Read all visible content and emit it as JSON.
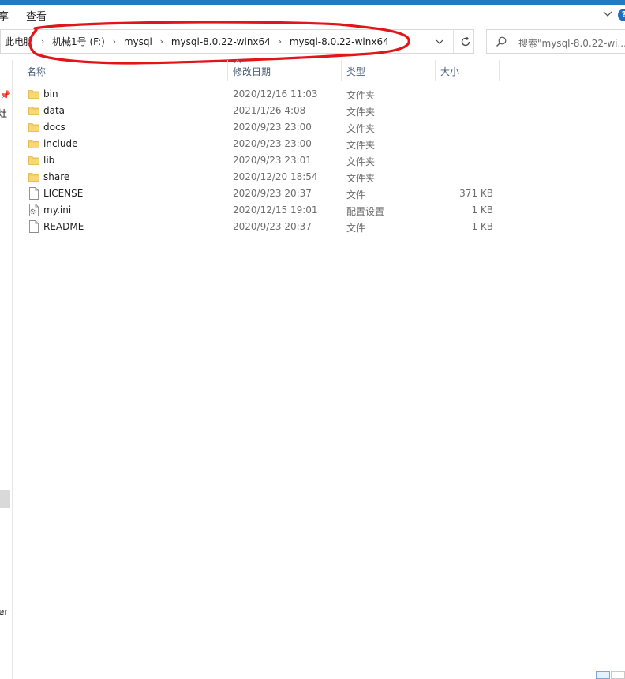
{
  "ribbon": {
    "tab_partial": "享",
    "tab_view": "查看",
    "help_label": "?"
  },
  "address": {
    "crumbs": [
      "此电脑",
      "机械1号 (F:)",
      "mysql",
      "mysql-8.0.22-winx64",
      "mysql-8.0.22-winx64"
    ]
  },
  "search": {
    "placeholder": "搜索\"mysql-8.0.22-wi..."
  },
  "columns": {
    "name": "名称",
    "date": "修改日期",
    "type": "类型",
    "size": "大小"
  },
  "nav": {
    "fragment_top": "灶",
    "fragment_bottom": "er"
  },
  "files": [
    {
      "name": "bin",
      "date": "2020/12/16 11:03",
      "type": "文件夹",
      "size": "",
      "icon": "folder-icon"
    },
    {
      "name": "data",
      "date": "2021/1/26 4:08",
      "type": "文件夹",
      "size": "",
      "icon": "folder-icon"
    },
    {
      "name": "docs",
      "date": "2020/9/23 23:00",
      "type": "文件夹",
      "size": "",
      "icon": "folder-icon"
    },
    {
      "name": "include",
      "date": "2020/9/23 23:00",
      "type": "文件夹",
      "size": "",
      "icon": "folder-icon"
    },
    {
      "name": "lib",
      "date": "2020/9/23 23:01",
      "type": "文件夹",
      "size": "",
      "icon": "folder-icon"
    },
    {
      "name": "share",
      "date": "2020/12/20 18:54",
      "type": "文件夹",
      "size": "",
      "icon": "folder-icon"
    },
    {
      "name": "LICENSE",
      "date": "2020/9/23 20:37",
      "type": "文件",
      "size": "371 KB",
      "icon": "file-icon"
    },
    {
      "name": "my.ini",
      "date": "2020/12/15 19:01",
      "type": "配置设置",
      "size": "1 KB",
      "icon": "settings-file-icon"
    },
    {
      "name": "README",
      "date": "2020/9/23 20:37",
      "type": "文件",
      "size": "1 KB",
      "icon": "file-icon"
    }
  ],
  "colors": {
    "accent": "#1f7bc4",
    "folder": "#f8d775",
    "annotation": "#e0161a"
  }
}
